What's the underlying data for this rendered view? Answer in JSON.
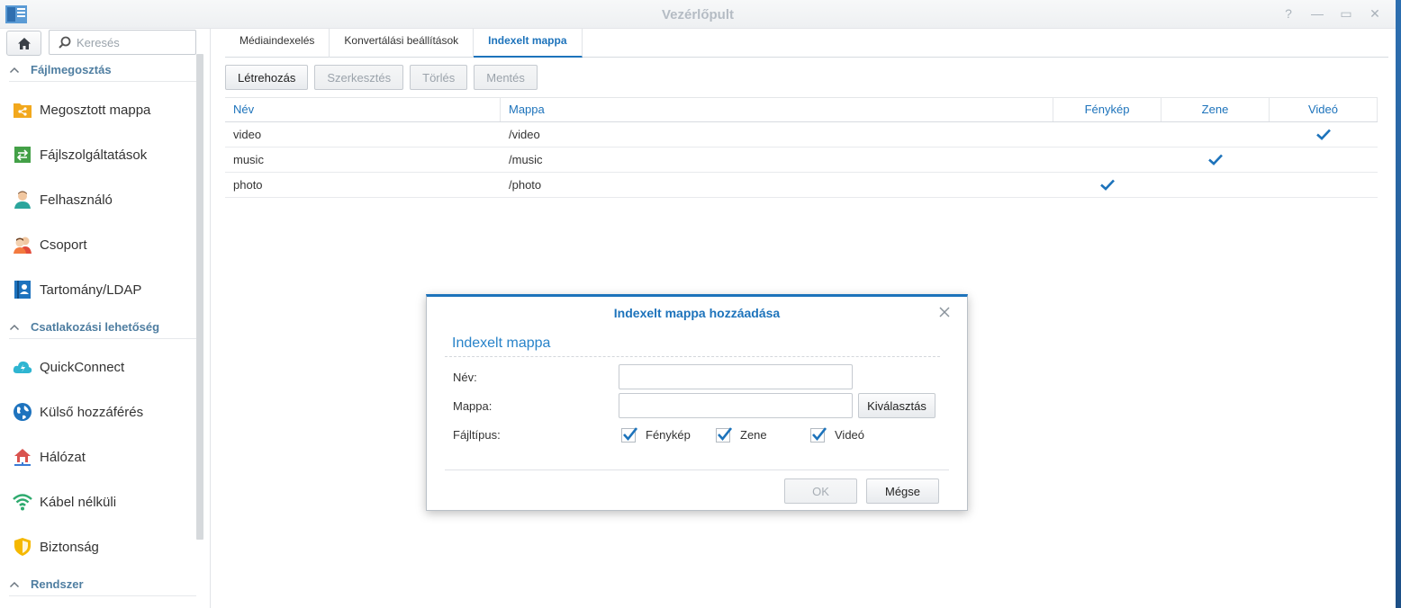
{
  "window": {
    "title": "Vezérlőpult",
    "controls": [
      "help-icon",
      "minimize-icon",
      "maximize-icon",
      "close-icon"
    ]
  },
  "sidebar": {
    "search_placeholder": "Keresés",
    "sections": [
      {
        "label": "Fájlmegosztás",
        "items": [
          {
            "label": "Megosztott mappa",
            "icon": "shared-folder-icon"
          },
          {
            "label": "Fájlszolgáltatások",
            "icon": "file-services-icon"
          },
          {
            "label": "Felhasználó",
            "icon": "user-icon"
          },
          {
            "label": "Csoport",
            "icon": "group-icon"
          },
          {
            "label": "Tartomány/LDAP",
            "icon": "domain-ldap-icon"
          }
        ]
      },
      {
        "label": "Csatlakozási lehetőség",
        "items": [
          {
            "label": "QuickConnect",
            "icon": "quickconnect-icon"
          },
          {
            "label": "Külső hozzáférés",
            "icon": "external-access-icon"
          },
          {
            "label": "Hálózat",
            "icon": "network-icon"
          },
          {
            "label": "Kábel nélküli",
            "icon": "wireless-icon"
          },
          {
            "label": "Biztonság",
            "icon": "security-icon"
          }
        ]
      },
      {
        "label": "Rendszer",
        "items": []
      }
    ]
  },
  "tabs": [
    {
      "label": "Médiaindexelés",
      "active": false
    },
    {
      "label": "Konvertálási beállítások",
      "active": false
    },
    {
      "label": "Indexelt mappa",
      "active": true
    }
  ],
  "toolbar": {
    "create": "Létrehozás",
    "edit": "Szerkesztés",
    "delete": "Törlés",
    "save": "Mentés"
  },
  "table": {
    "columns": [
      "Név",
      "Mappa",
      "Fénykép",
      "Zene",
      "Videó"
    ],
    "rows": [
      {
        "name": "video",
        "path": "/video",
        "photo": false,
        "music": false,
        "video": true
      },
      {
        "name": "music",
        "path": "/music",
        "photo": false,
        "music": true,
        "video": false
      },
      {
        "name": "photo",
        "path": "/photo",
        "photo": true,
        "music": false,
        "video": false
      }
    ]
  },
  "dialog": {
    "title": "Indexelt mappa hozzáadása",
    "section": "Indexelt mappa",
    "name_label": "Név:",
    "name_value": "",
    "folder_label": "Mappa:",
    "folder_value": "",
    "select_button": "Kiválasztás",
    "filetype_label": "Fájltípus:",
    "filetypes": [
      {
        "label": "Fénykép",
        "checked": true
      },
      {
        "label": "Zene",
        "checked": true
      },
      {
        "label": "Videó",
        "checked": true
      }
    ],
    "ok": "OK",
    "cancel": "Mégse"
  },
  "colors": {
    "accent": "#1d73bb",
    "section": "#4f7ea1"
  }
}
